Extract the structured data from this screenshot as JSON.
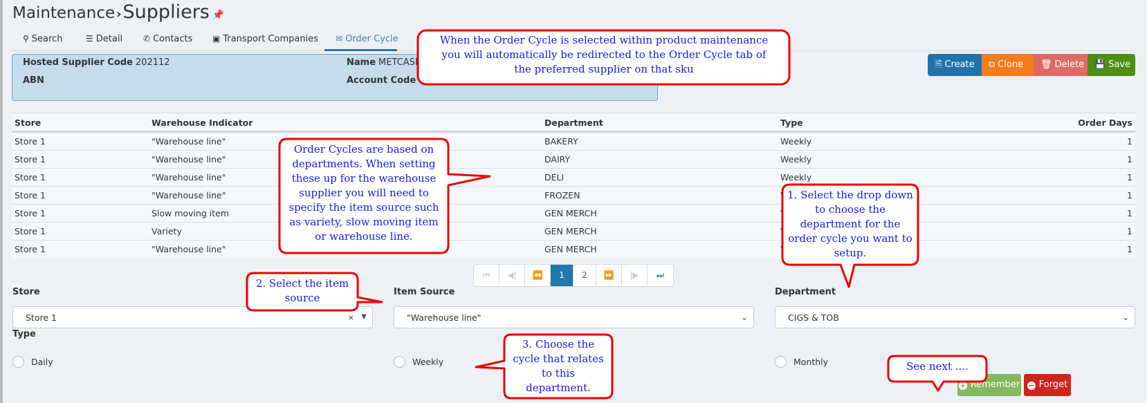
{
  "header": {
    "breadcrumb_parent": "Maintenance",
    "breadcrumb_separator": "›",
    "title": "Suppliers",
    "pin_icon": "✱"
  },
  "tabs": [
    {
      "icon": "search-icon",
      "glyph": "🔍",
      "label": "Search",
      "active": false
    },
    {
      "icon": "list-icon",
      "glyph": "☰",
      "label": "Detail",
      "active": false
    },
    {
      "icon": "phone-icon",
      "glyph": "✆",
      "label": "Contacts",
      "active": false
    },
    {
      "icon": "bus-icon",
      "glyph": "▣",
      "label": "Transport Companies",
      "active": false
    },
    {
      "icon": "envelope-icon",
      "glyph": "✉",
      "label": "Order Cycle",
      "active": true
    }
  ],
  "info": {
    "hosted_supplier_code_label": "Hosted Supplier Code",
    "hosted_supplier_code_value": "202112",
    "abn_label": "ABN",
    "abn_value": "",
    "name_label": "Name",
    "name_value": "METCASH",
    "account_code_label": "Account Code",
    "account_code_value": ""
  },
  "toolbar": {
    "create_label": "Create",
    "clone_label": "Clone",
    "delete_label": "Delete",
    "save_label": "Save",
    "colors": {
      "create": "#2172ac",
      "clone": "#f47c1c",
      "delete": "#e06a63",
      "save": "#4c8f13"
    }
  },
  "table": {
    "columns": [
      "Store",
      "Warehouse Indicator",
      "Department",
      "Type",
      "Order Days"
    ],
    "rows": [
      [
        "Store 1",
        "\"Warehouse line\"",
        "BAKERY",
        "Weekly",
        "1"
      ],
      [
        "Store 1",
        "\"Warehouse line\"",
        "DAIRY",
        "Weekly",
        "1"
      ],
      [
        "Store 1",
        "\"Warehouse line\"",
        "DELI",
        "Weekly",
        "1"
      ],
      [
        "Store 1",
        "\"Warehouse line\"",
        "FROZEN",
        "Weekly",
        "1"
      ],
      [
        "Store 1",
        "Slow moving item",
        "GEN MERCH",
        "Weekly",
        "1"
      ],
      [
        "Store 1",
        "Variety",
        "GEN MERCH",
        "Weekly",
        "1"
      ],
      [
        "Store 1",
        "\"Warehouse line\"",
        "GEN MERCH",
        "Weekly",
        "1"
      ]
    ]
  },
  "pagination": {
    "first": "⏮",
    "prev": "⏴",
    "prev_group": "◀◀",
    "pages": [
      "1",
      "2"
    ],
    "current_page": "1",
    "next_group": "▶▶",
    "next": "⏵",
    "last": "⏭"
  },
  "form": {
    "store_label": "Store",
    "store_value": "Store 1",
    "item_source_label": "Item Source",
    "item_source_value": "\"Warehouse line\"",
    "department_label": "Department",
    "department_value": "CIGS & TOB",
    "type_label": "Type",
    "type_options": [
      "Daily",
      "Weekly",
      "Monthly"
    ],
    "type_selected": null
  },
  "actions": {
    "remember_label": "Remember",
    "forget_label": "Forget"
  },
  "callouts": {
    "c0": "When the Order Cycle is selected within product maintenance you will automatically be redirected to the Order Cycle tab of the preferred supplier on that sku",
    "c1": "Order Cycles are based on departments.  When setting these up for the warehouse supplier you will need to specify the item source such as variety, slow moving item or warehouse line.",
    "c2": "1. Select the drop down to choose the department for the order cycle you want to setup.",
    "c3": "2. Select the item source",
    "c4": "3. Choose the cycle that relates to this department.",
    "c5": "See next ...."
  }
}
